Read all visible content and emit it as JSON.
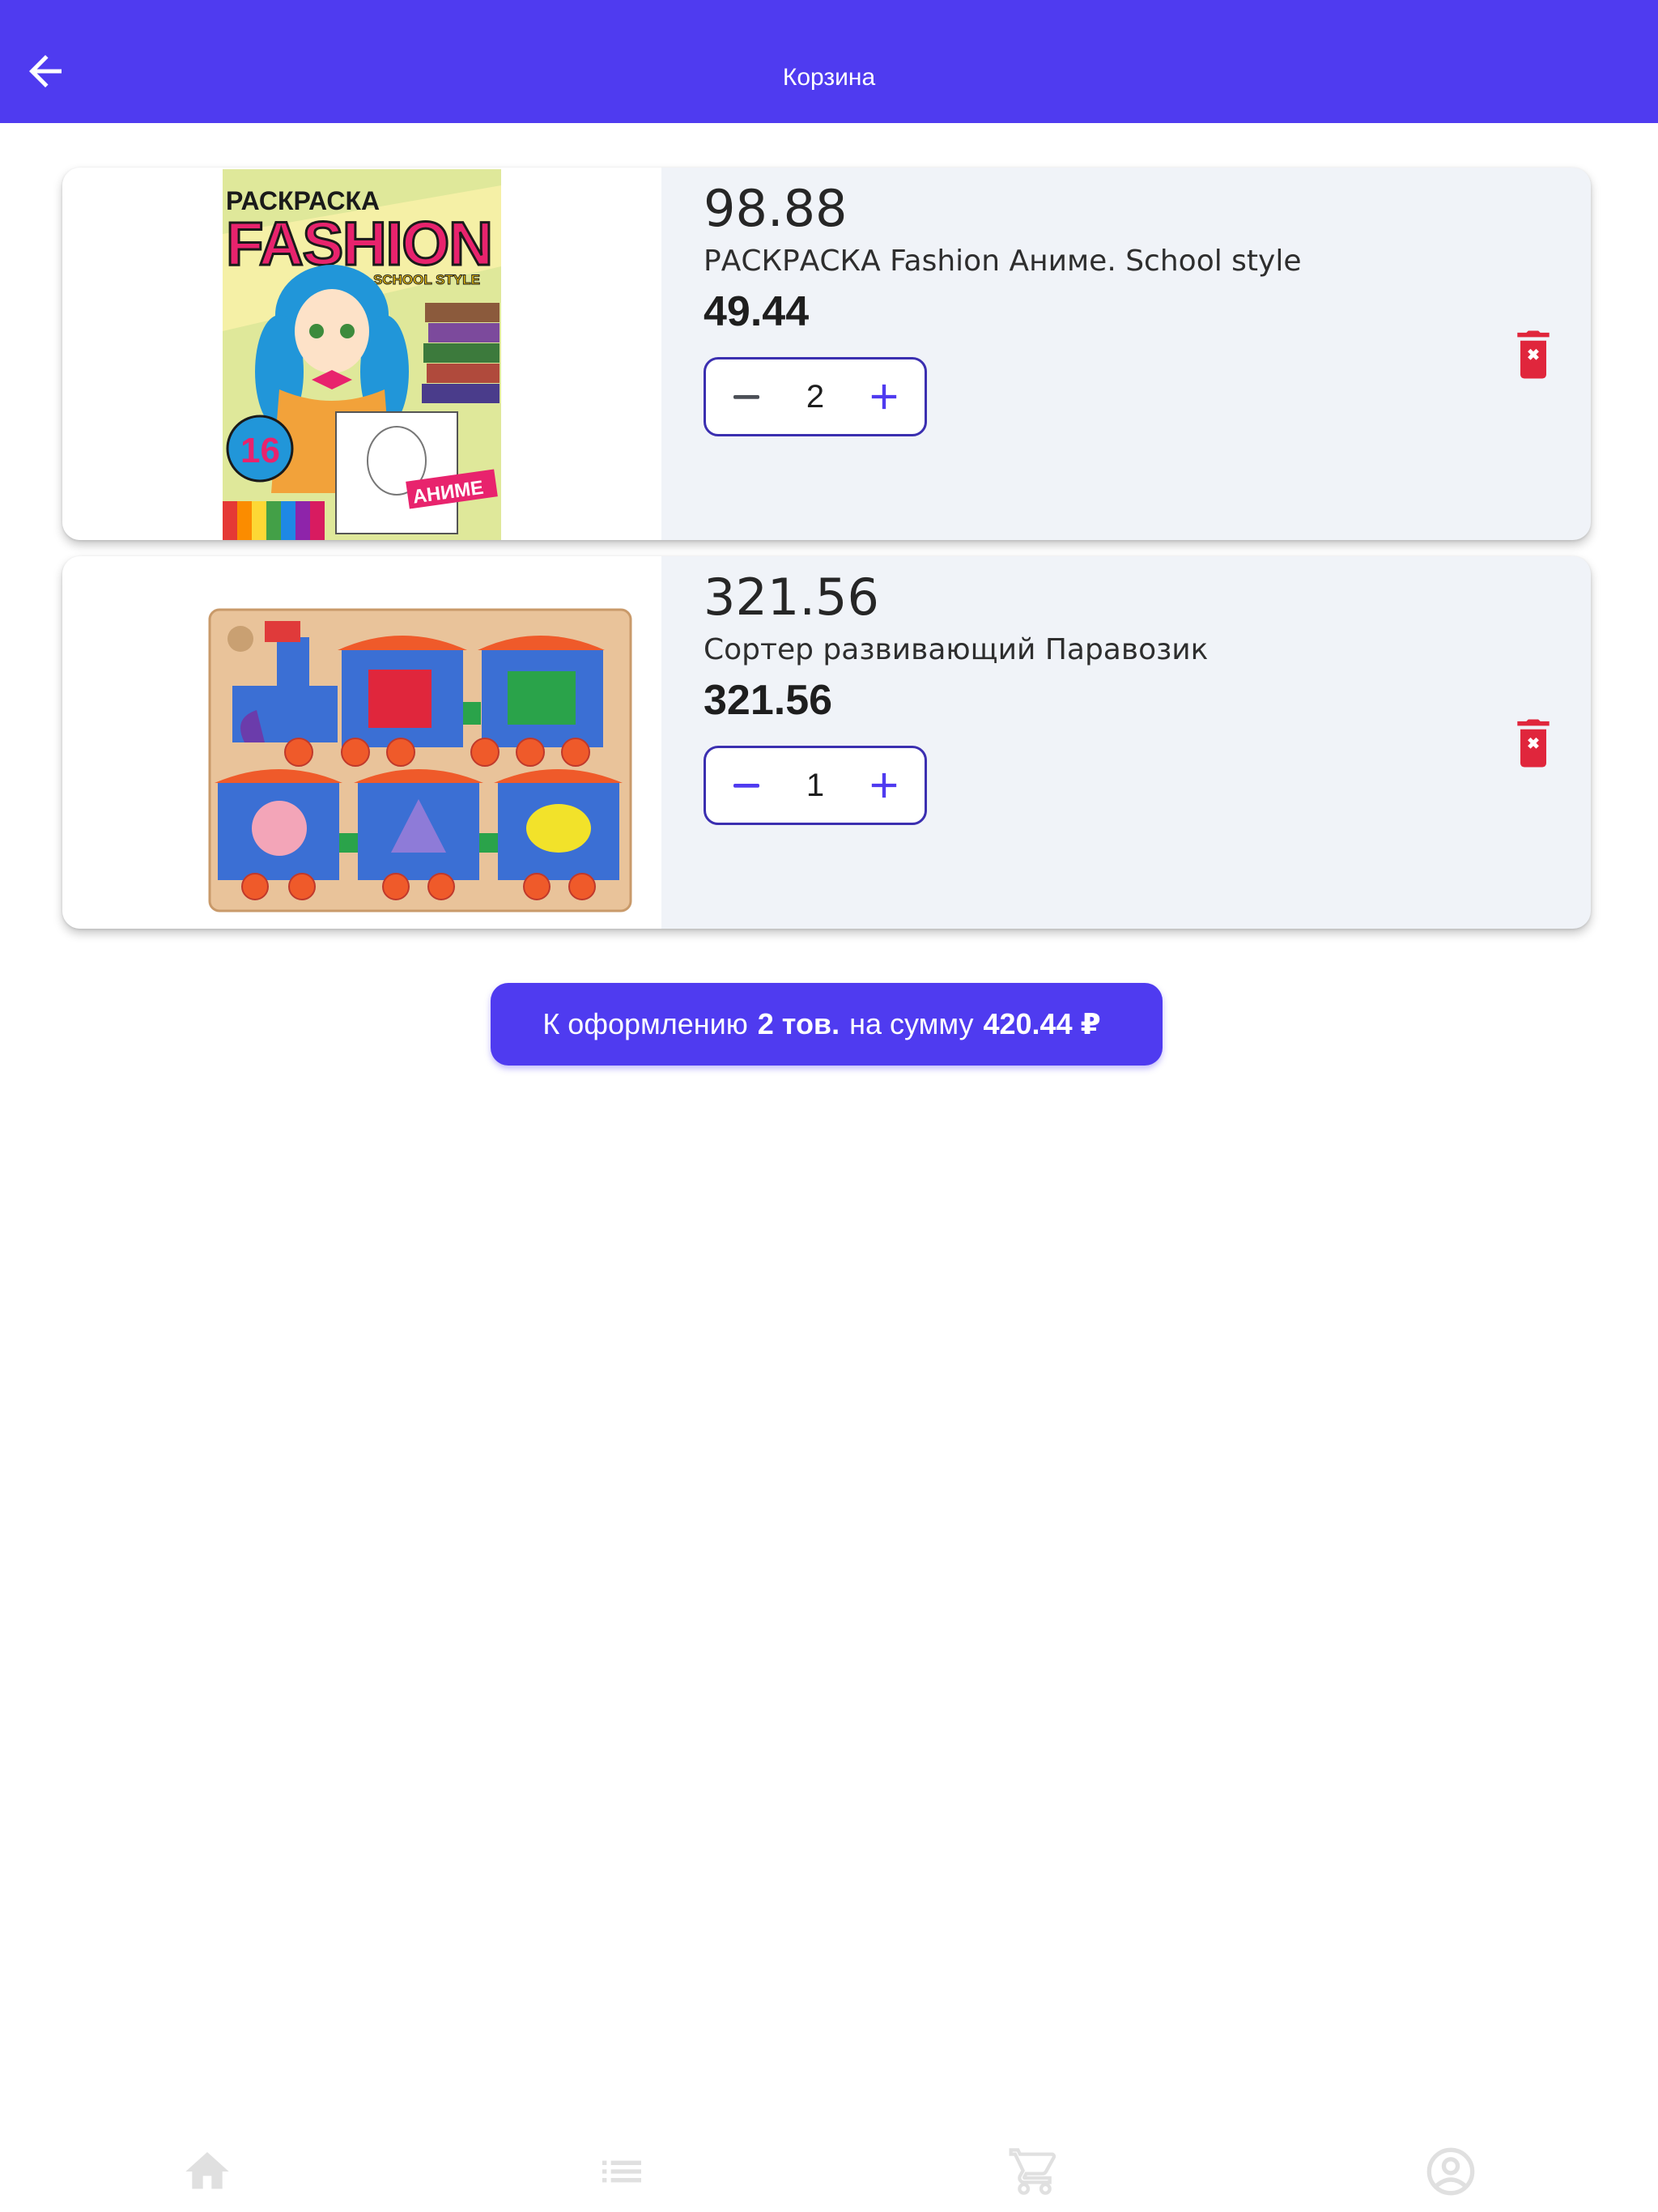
{
  "appbar": {
    "title": "Корзина",
    "back_icon": "arrow-left-icon"
  },
  "colors": {
    "primary": "#4f3bf0",
    "card_bg": "#f0f3f8",
    "delete": "#e0263c",
    "stepper_border": "#3b2fb0",
    "nav_icon": "#e0e0e0"
  },
  "cart": {
    "items": [
      {
        "old_price": "98.88",
        "name": "РАСКРАСКА Fashion Аниме. School style",
        "price": "49.44",
        "quantity": "2",
        "image": {
          "title": "РАСКРАСКА",
          "brand": "FASHION",
          "subtitle": "SCHOOL STYLE",
          "badge": "16",
          "tag": "АНИМЕ"
        }
      },
      {
        "old_price": "321.56",
        "name": "Сортер развивающий Паравозик",
        "price": "321.56",
        "quantity": "1"
      }
    ]
  },
  "checkout": {
    "prefix": "К оформлению",
    "count": "2 тов.",
    "middle": "на сумму",
    "total": "420.44 ₽"
  },
  "bottom_nav": [
    {
      "icon": "home-icon"
    },
    {
      "icon": "catalog-list-icon"
    },
    {
      "icon": "cart-icon"
    },
    {
      "icon": "account-circle-icon"
    }
  ]
}
